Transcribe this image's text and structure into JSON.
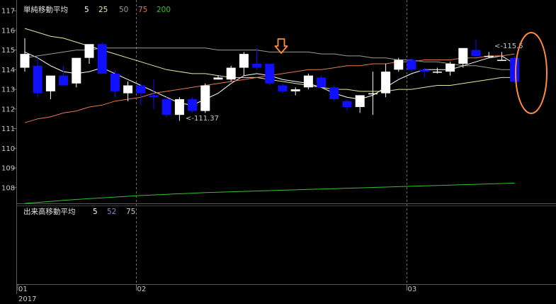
{
  "colors": {
    "background": "#000000",
    "frame": "#5a5a5a",
    "grid": "#6e6e6e",
    "candle_up": "#ffffff",
    "candle_down": "#1010ff",
    "ma5": "#ffffff",
    "ma25": "#e8e8a0",
    "ma50": "#a09a8a",
    "ma75": "#e67850",
    "ma200": "#30c030",
    "marker": "#ff8c3c"
  },
  "price_panel": {
    "legend_title": "単純移動平均",
    "legend_periods": [
      "5",
      "25",
      "50",
      "75",
      "200"
    ],
    "high_label": "<-115.5",
    "low_label": "<-111.37"
  },
  "volume_panel": {
    "legend_title": "出来高移動平均",
    "legend_periods": [
      "5",
      "52",
      "75"
    ]
  },
  "chart_data": {
    "type": "candlestick",
    "y_ticks": [
      108,
      109,
      110,
      111,
      112,
      113,
      114,
      115,
      116,
      117
    ],
    "ylim": [
      107.2,
      117.4
    ],
    "x_tick_labels": [
      "01",
      "02",
      "03"
    ],
    "x_tick_index": [
      0,
      9,
      30
    ],
    "year_label": "2017",
    "grid": "vertical month lines (dashed)",
    "candles": [
      {
        "o": 114.1,
        "h": 115.6,
        "l": 113.9,
        "c": 114.8
      },
      {
        "o": 114.2,
        "h": 114.6,
        "l": 112.6,
        "c": 112.8
      },
      {
        "o": 112.9,
        "h": 113.3,
        "l": 112.5,
        "c": 113.7
      },
      {
        "o": 113.7,
        "h": 114.2,
        "l": 113.4,
        "c": 113.2
      },
      {
        "o": 113.3,
        "h": 114.6,
        "l": 113.1,
        "c": 114.6
      },
      {
        "o": 114.6,
        "h": 115.2,
        "l": 114.3,
        "c": 115.3
      },
      {
        "o": 115.3,
        "h": 115.4,
        "l": 113.8,
        "c": 113.8
      },
      {
        "o": 113.8,
        "h": 114.0,
        "l": 112.6,
        "c": 112.9
      },
      {
        "o": 112.8,
        "h": 113.4,
        "l": 112.4,
        "c": 113.2
      },
      {
        "o": 113.2,
        "h": 113.3,
        "l": 112.2,
        "c": 112.8
      },
      {
        "o": 112.7,
        "h": 113.5,
        "l": 112.0,
        "c": 112.6
      },
      {
        "o": 112.5,
        "h": 112.6,
        "l": 111.6,
        "c": 111.7
      },
      {
        "o": 111.7,
        "h": 112.6,
        "l": 111.4,
        "c": 112.5
      },
      {
        "o": 112.5,
        "h": 112.6,
        "l": 111.8,
        "c": 111.9
      },
      {
        "o": 111.9,
        "h": 113.3,
        "l": 111.8,
        "c": 113.2
      },
      {
        "o": 113.5,
        "h": 113.7,
        "l": 113.5,
        "c": 113.6
      },
      {
        "o": 113.5,
        "h": 114.2,
        "l": 113.4,
        "c": 114.1
      },
      {
        "o": 114.1,
        "h": 114.9,
        "l": 113.7,
        "c": 114.8
      },
      {
        "o": 114.3,
        "h": 115.1,
        "l": 114.0,
        "c": 114.1
      },
      {
        "o": 114.3,
        "h": 114.3,
        "l": 113.2,
        "c": 113.3
      },
      {
        "o": 113.2,
        "h": 113.3,
        "l": 112.8,
        "c": 112.9
      },
      {
        "o": 112.9,
        "h": 113.1,
        "l": 112.7,
        "c": 113.0
      },
      {
        "o": 113.1,
        "h": 113.8,
        "l": 113.0,
        "c": 113.7
      },
      {
        "o": 113.6,
        "h": 113.7,
        "l": 113.1,
        "c": 113.1
      },
      {
        "o": 113.1,
        "h": 113.2,
        "l": 112.4,
        "c": 112.5
      },
      {
        "o": 112.4,
        "h": 112.5,
        "l": 111.9,
        "c": 112.1
      },
      {
        "o": 112.1,
        "h": 112.3,
        "l": 111.8,
        "c": 112.7
      },
      {
        "o": 112.8,
        "h": 113.9,
        "l": 111.7,
        "c": 112.8
      },
      {
        "o": 112.8,
        "h": 114.3,
        "l": 112.6,
        "c": 113.9
      },
      {
        "o": 114.0,
        "h": 114.6,
        "l": 113.9,
        "c": 114.5
      },
      {
        "o": 114.5,
        "h": 114.6,
        "l": 113.9,
        "c": 114.0
      },
      {
        "o": 114.0,
        "h": 114.1,
        "l": 113.6,
        "c": 113.9
      },
      {
        "o": 113.9,
        "h": 114.1,
        "l": 113.8,
        "c": 113.9
      },
      {
        "o": 113.9,
        "h": 114.4,
        "l": 113.7,
        "c": 114.3
      },
      {
        "o": 114.3,
        "h": 115.1,
        "l": 114.1,
        "c": 115.1
      },
      {
        "o": 115.0,
        "h": 115.5,
        "l": 114.7,
        "c": 114.7
      },
      {
        "o": 114.7,
        "h": 114.9,
        "l": 114.6,
        "c": 114.7
      },
      {
        "o": 114.5,
        "h": 114.9,
        "l": 114.5,
        "c": 114.5
      },
      {
        "o": 114.6,
        "h": 114.7,
        "l": 113.3,
        "c": 113.4
      }
    ],
    "series": [
      {
        "name": "5",
        "color_key": "ma5",
        "values": [
          114.9,
          114.6,
          114.2,
          113.9,
          113.8,
          113.9,
          114.1,
          113.8,
          113.5,
          113.2,
          112.9,
          112.6,
          112.3,
          112.2,
          112.5,
          112.8,
          113.3,
          113.7,
          113.8,
          113.7,
          113.5,
          113.4,
          113.3,
          113.1,
          112.8,
          112.6,
          112.5,
          112.7,
          113.1,
          113.5,
          113.8,
          114.0,
          114.0,
          114.0,
          114.2,
          114.4,
          114.6,
          114.7,
          114.3
        ]
      },
      {
        "name": "25",
        "color_key": "ma25",
        "values": [
          116.1,
          115.9,
          115.7,
          115.6,
          115.4,
          115.2,
          115.0,
          114.8,
          114.6,
          114.4,
          114.2,
          114.0,
          113.9,
          113.8,
          113.8,
          113.7,
          113.6,
          113.6,
          113.6,
          113.5,
          113.4,
          113.3,
          113.2,
          113.1,
          113.0,
          113.0,
          112.9,
          112.9,
          112.9,
          113.0,
          113.0,
          113.1,
          113.2,
          113.2,
          113.3,
          113.4,
          113.5,
          113.6,
          113.6
        ]
      },
      {
        "name": "50",
        "color_key": "ma50",
        "values": [
          114.6,
          114.7,
          114.8,
          114.9,
          115.0,
          115.0,
          115.1,
          115.1,
          115.1,
          115.1,
          115.1,
          115.1,
          115.1,
          115.1,
          115.1,
          115.0,
          115.0,
          115.0,
          115.0,
          114.9,
          114.9,
          114.9,
          114.9,
          114.8,
          114.8,
          114.7,
          114.7,
          114.6,
          114.6,
          114.5,
          114.5,
          114.4,
          114.4,
          114.3,
          114.2,
          114.2,
          114.1,
          114.0,
          114.0
        ]
      },
      {
        "name": "75",
        "color_key": "ma75",
        "values": [
          111.3,
          111.5,
          111.6,
          111.8,
          111.9,
          112.1,
          112.2,
          112.4,
          112.5,
          112.6,
          112.8,
          112.9,
          113.0,
          113.1,
          113.2,
          113.3,
          113.4,
          113.5,
          113.6,
          113.7,
          113.8,
          113.9,
          114.0,
          114.0,
          114.1,
          114.2,
          114.2,
          114.3,
          114.3,
          114.4,
          114.4,
          114.5,
          114.5,
          114.5,
          114.6,
          114.6,
          114.7,
          114.7,
          114.8
        ]
      },
      {
        "name": "200",
        "color_key": "ma200",
        "values": [
          107.2,
          107.25,
          107.3,
          107.35,
          107.4,
          107.44,
          107.48,
          107.52,
          107.56,
          107.6,
          107.63,
          107.66,
          107.69,
          107.72,
          107.75,
          107.77,
          107.79,
          107.81,
          107.83,
          107.85,
          107.87,
          107.89,
          107.91,
          107.93,
          107.95,
          107.97,
          107.99,
          108.01,
          108.03,
          108.05,
          108.07,
          108.09,
          108.11,
          108.13,
          108.15,
          108.17,
          108.19,
          108.21,
          108.23
        ]
      }
    ]
  }
}
